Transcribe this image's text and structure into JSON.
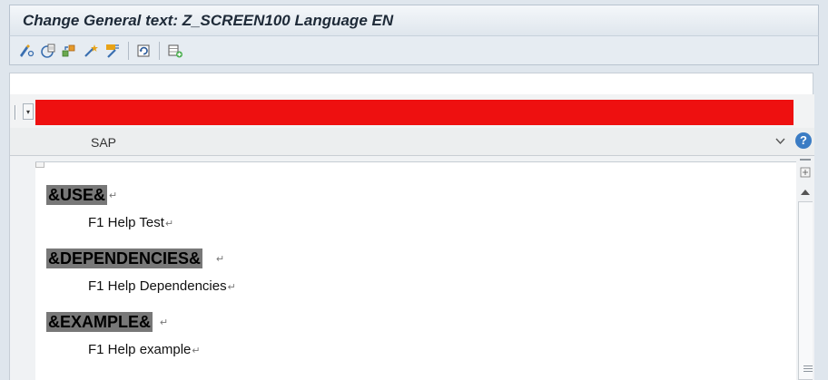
{
  "window": {
    "title": "Change General text: Z_SCREEN100 Language EN"
  },
  "toolbar": {
    "icons": [
      "display-change-icon",
      "activate-icon",
      "other-object-icon",
      "magic-wand-icon",
      "format-icon",
      "refresh-icon",
      "insert-row-icon"
    ]
  },
  "editor": {
    "sap_label": "SAP",
    "colors": {
      "red_bar": "#ee1010",
      "heading_bg": "#787878",
      "help_blue": "#3b7cc4"
    },
    "help_glyph": "?",
    "sections": [
      {
        "heading": "&USE&",
        "text": "F1 Help Test"
      },
      {
        "heading": "&DEPENDENCIES&",
        "text": "F1 Help Dependencies"
      },
      {
        "heading": "&EXAMPLE&",
        "text": "F1 Help example"
      }
    ],
    "paragraph_mark": "↵"
  }
}
